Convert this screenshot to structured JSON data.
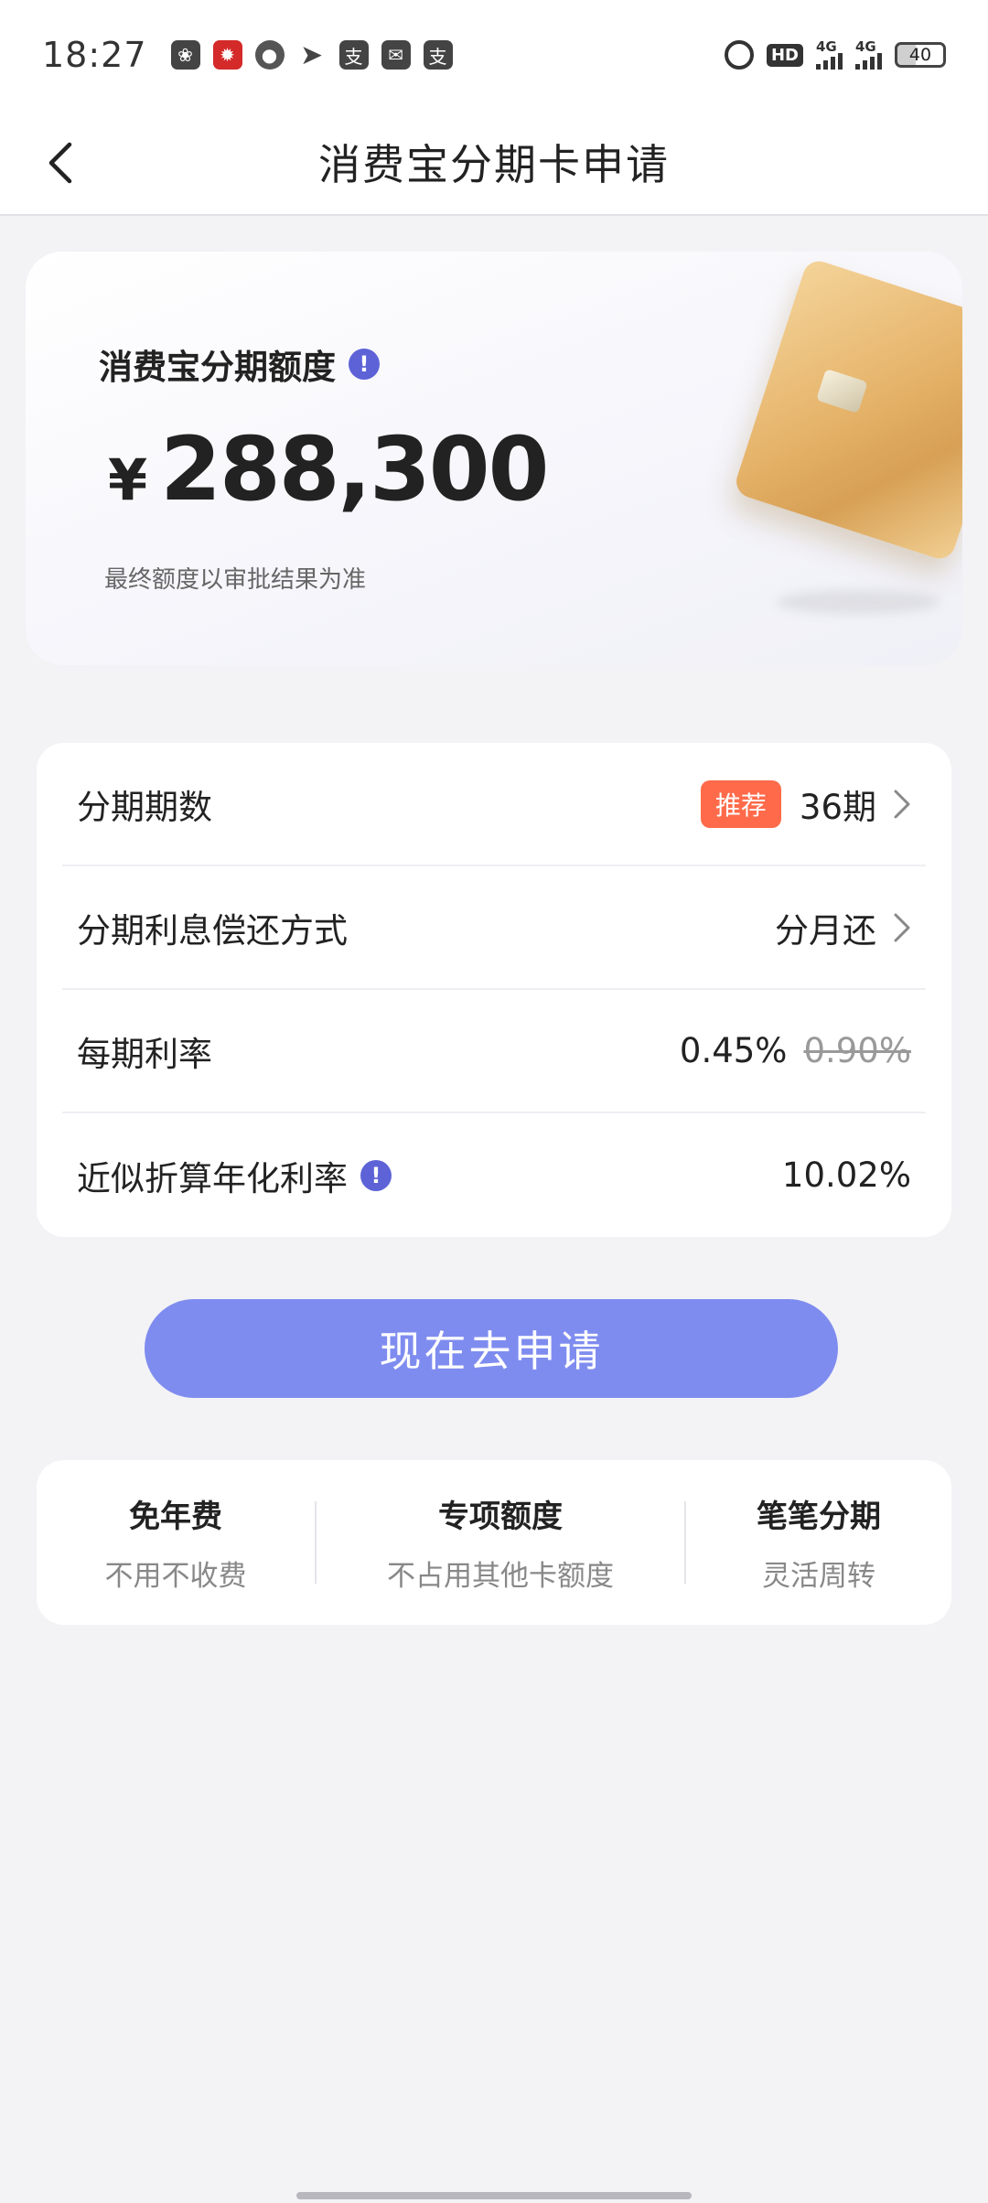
{
  "status_bar": {
    "time": "18:27",
    "network_1": "4G",
    "network_2": "4G",
    "battery": "40",
    "hd_label": "HD"
  },
  "header": {
    "title": "消费宝分期卡申请"
  },
  "limit_card": {
    "label": "消费宝分期额度",
    "currency": "¥",
    "amount": "288,300",
    "note": "最终额度以审批结果为准"
  },
  "details": {
    "installments": {
      "label": "分期期数",
      "badge": "推荐",
      "value": "36期"
    },
    "repayment": {
      "label": "分期利息偿还方式",
      "value": "分月还"
    },
    "rate": {
      "label": "每期利率",
      "value": "0.45%",
      "original": "0.90%"
    },
    "annual": {
      "label": "近似折算年化利率",
      "value": "10.02%"
    }
  },
  "apply_button": {
    "label": "现在去申请"
  },
  "features": [
    {
      "title": "免年费",
      "subtitle": "不用不收费"
    },
    {
      "title": "专项额度",
      "subtitle": "不占用其他卡额度"
    },
    {
      "title": "笔笔分期",
      "subtitle": "灵活周转"
    }
  ],
  "colors": {
    "accent": "#7f8cef",
    "info_icon": "#5d63d6",
    "badge": "#ff6a4a"
  }
}
